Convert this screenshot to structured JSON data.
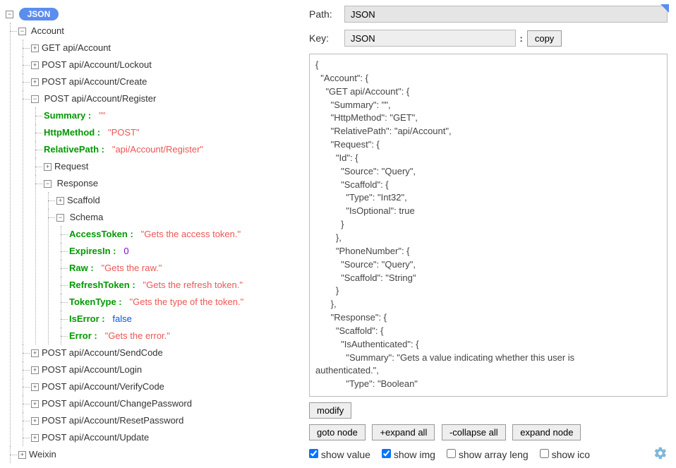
{
  "tree": {
    "root": "JSON",
    "account": "Account",
    "items": [
      "GET api/Account",
      "POST api/Account/Lockout",
      "POST api/Account/Create",
      "POST api/Account/Register"
    ],
    "register": {
      "summary_k": "Summary :",
      "summary_v": "\"\"",
      "http_k": "HttpMethod :",
      "http_v": "\"POST\"",
      "rel_k": "RelativePath :",
      "rel_v": "\"api/Account/Register\"",
      "request": "Request",
      "response": "Response",
      "scaffold": "Scaffold",
      "schema": "Schema",
      "props": {
        "at_k": "AccessToken :",
        "at_v": "\"Gets the access token.\"",
        "ei_k": "ExpiresIn :",
        "ei_v": "0",
        "raw_k": "Raw :",
        "raw_v": "\"Gets the raw.\"",
        "rt_k": "RefreshToken :",
        "rt_v": "\"Gets the refresh token.\"",
        "tt_k": "TokenType :",
        "tt_v": "\"Gets the type of the token.\"",
        "ie_k": "IsError :",
        "ie_v": "false",
        "er_k": "Error :",
        "er_v": "\"Gets the error.\""
      }
    },
    "items_after": [
      "POST api/Account/SendCode",
      "POST api/Account/Login",
      "POST api/Account/VerifyCode",
      "POST api/Account/ChangePassword",
      "POST api/Account/ResetPassword",
      "POST api/Account/Update"
    ],
    "weixin": "Weixin"
  },
  "form": {
    "path_label": "Path:",
    "path_value": "JSON",
    "key_label": "Key:",
    "key_value": "JSON",
    "copy": "copy"
  },
  "json_text": "{\n  \"Account\": {\n    \"GET api/Account\": {\n      \"Summary\": \"\",\n      \"HttpMethod\": \"GET\",\n      \"RelativePath\": \"api/Account\",\n      \"Request\": {\n        \"Id\": {\n          \"Source\": \"Query\",\n          \"Scaffold\": {\n            \"Type\": \"Int32\",\n            \"IsOptional\": true\n          }\n        },\n        \"PhoneNumber\": {\n          \"Source\": \"Query\",\n          \"Scaffold\": \"String\"\n        }\n      },\n      \"Response\": {\n        \"Scaffold\": {\n          \"IsAuthenticated\": {\n            \"Summary\": \"Gets a value indicating whether this user is\nauthenticated.\",\n            \"Type\": \"Boolean\"",
  "buttons": {
    "modify": "modify",
    "goto": "goto node",
    "expand_all": "+expand all",
    "collapse_all": "-collapse all",
    "expand_node": "expand node"
  },
  "opts": {
    "show_value": "show value",
    "show_img": "show img",
    "show_arrlen": "show array leng",
    "show_ico": "show ico"
  }
}
